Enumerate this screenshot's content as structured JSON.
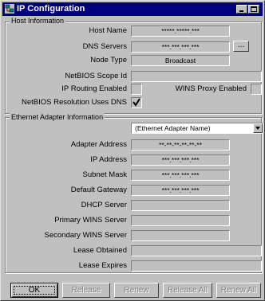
{
  "window": {
    "title": "IP Configuration",
    "icon": "network-icon"
  },
  "host": {
    "group_label": "Host Information",
    "host_name_label": "Host Name",
    "host_name_value": "*****.*****.***",
    "dns_servers_label": "DNS Servers",
    "dns_servers_value": "***.***.***.***",
    "dns_more_button": "...",
    "node_type_label": "Node Type",
    "node_type_value": "Broadcast",
    "netbios_scope_label": "NetBIOS Scope Id",
    "netbios_scope_value": "",
    "ip_routing_label": "IP Routing Enabled",
    "ip_routing_checked": false,
    "wins_proxy_label": "WINS Proxy Enabled",
    "wins_proxy_checked": false,
    "netbios_dns_label": "NetBIOS Resolution Uses DNS",
    "netbios_dns_checked": true
  },
  "adapter": {
    "group_label": "Ethernet Adapter Information",
    "selected_adapter": "(Ethernet Adapter Name)",
    "adapter_address_label": "Adapter Address",
    "adapter_address_value": "**-**-**-**-**-**",
    "ip_address_label": "IP Address",
    "ip_address_value": "***.***.***.***",
    "subnet_mask_label": "Subnet Mask",
    "subnet_mask_value": "***.***.***.***",
    "default_gateway_label": "Default Gateway",
    "default_gateway_value": "***.***.***.***",
    "dhcp_server_label": "DHCP Server",
    "dhcp_server_value": "",
    "primary_wins_label": "Primary WINS Server",
    "primary_wins_value": "",
    "secondary_wins_label": "Secondary WINS Server",
    "secondary_wins_value": "",
    "lease_obtained_label": "Lease Obtained",
    "lease_obtained_value": "",
    "lease_expires_label": "Lease Expires",
    "lease_expires_value": ""
  },
  "buttons": {
    "ok": "OK",
    "release": "Release",
    "renew": "Renew",
    "release_all": "Release All",
    "renew_all": "Renew All"
  }
}
